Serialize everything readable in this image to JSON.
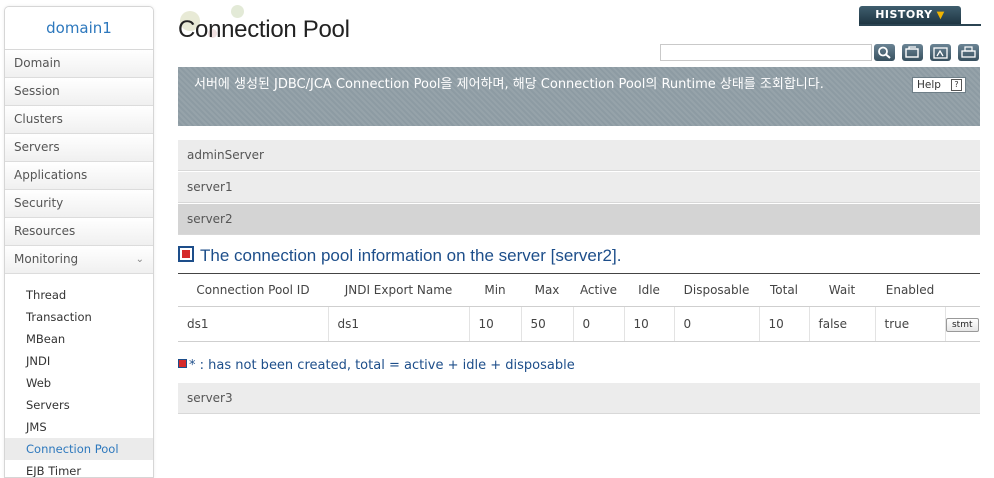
{
  "sidebar": {
    "domain": "domain1",
    "items": [
      {
        "label": "Domain"
      },
      {
        "label": "Session"
      },
      {
        "label": "Clusters"
      },
      {
        "label": "Servers"
      },
      {
        "label": "Applications"
      },
      {
        "label": "Security"
      },
      {
        "label": "Resources"
      },
      {
        "label": "Monitoring"
      }
    ],
    "monitoring_sub": [
      {
        "label": "Thread"
      },
      {
        "label": "Transaction"
      },
      {
        "label": "MBean"
      },
      {
        "label": "JNDI"
      },
      {
        "label": "Web"
      },
      {
        "label": "Servers"
      },
      {
        "label": "JMS"
      },
      {
        "label": "Connection Pool"
      },
      {
        "label": "EJB Timer"
      }
    ]
  },
  "header": {
    "title": "Connection Pool",
    "history_label": "HISTORY",
    "search_value": ""
  },
  "banner": {
    "text": "서버에 생성된 JDBC/JCA Connection Pool을 제어하며, 해당 Connection Pool의 Runtime 상태를 조회합니다.",
    "help_label": "Help",
    "help_q": "?"
  },
  "servers": [
    "adminServer",
    "server1",
    "server2",
    "server3"
  ],
  "section": {
    "title": "The connection pool information on the server [server2]."
  },
  "table": {
    "headers": [
      "Connection Pool ID",
      "JNDI Export Name",
      "Min",
      "Max",
      "Active",
      "Idle",
      "Disposable",
      "Total",
      "Wait",
      "Enabled",
      ""
    ],
    "rows": [
      {
        "id": "ds1",
        "jndi": "ds1",
        "min": "10",
        "max": "50",
        "active": "0",
        "idle": "10",
        "disposable": "0",
        "total": "10",
        "wait": "false",
        "enabled": "true",
        "action": "stmt"
      }
    ]
  },
  "legend": {
    "star": "*",
    "text": ": has not been created, total = active + idle + disposable"
  },
  "colors": {
    "accent": "#2d78bd",
    "section": "#1d4e8a",
    "banner": "#8d9ba3",
    "history": "#2b4452",
    "history_arrow": "#f0b400",
    "icon_red": "#d52a2a"
  }
}
